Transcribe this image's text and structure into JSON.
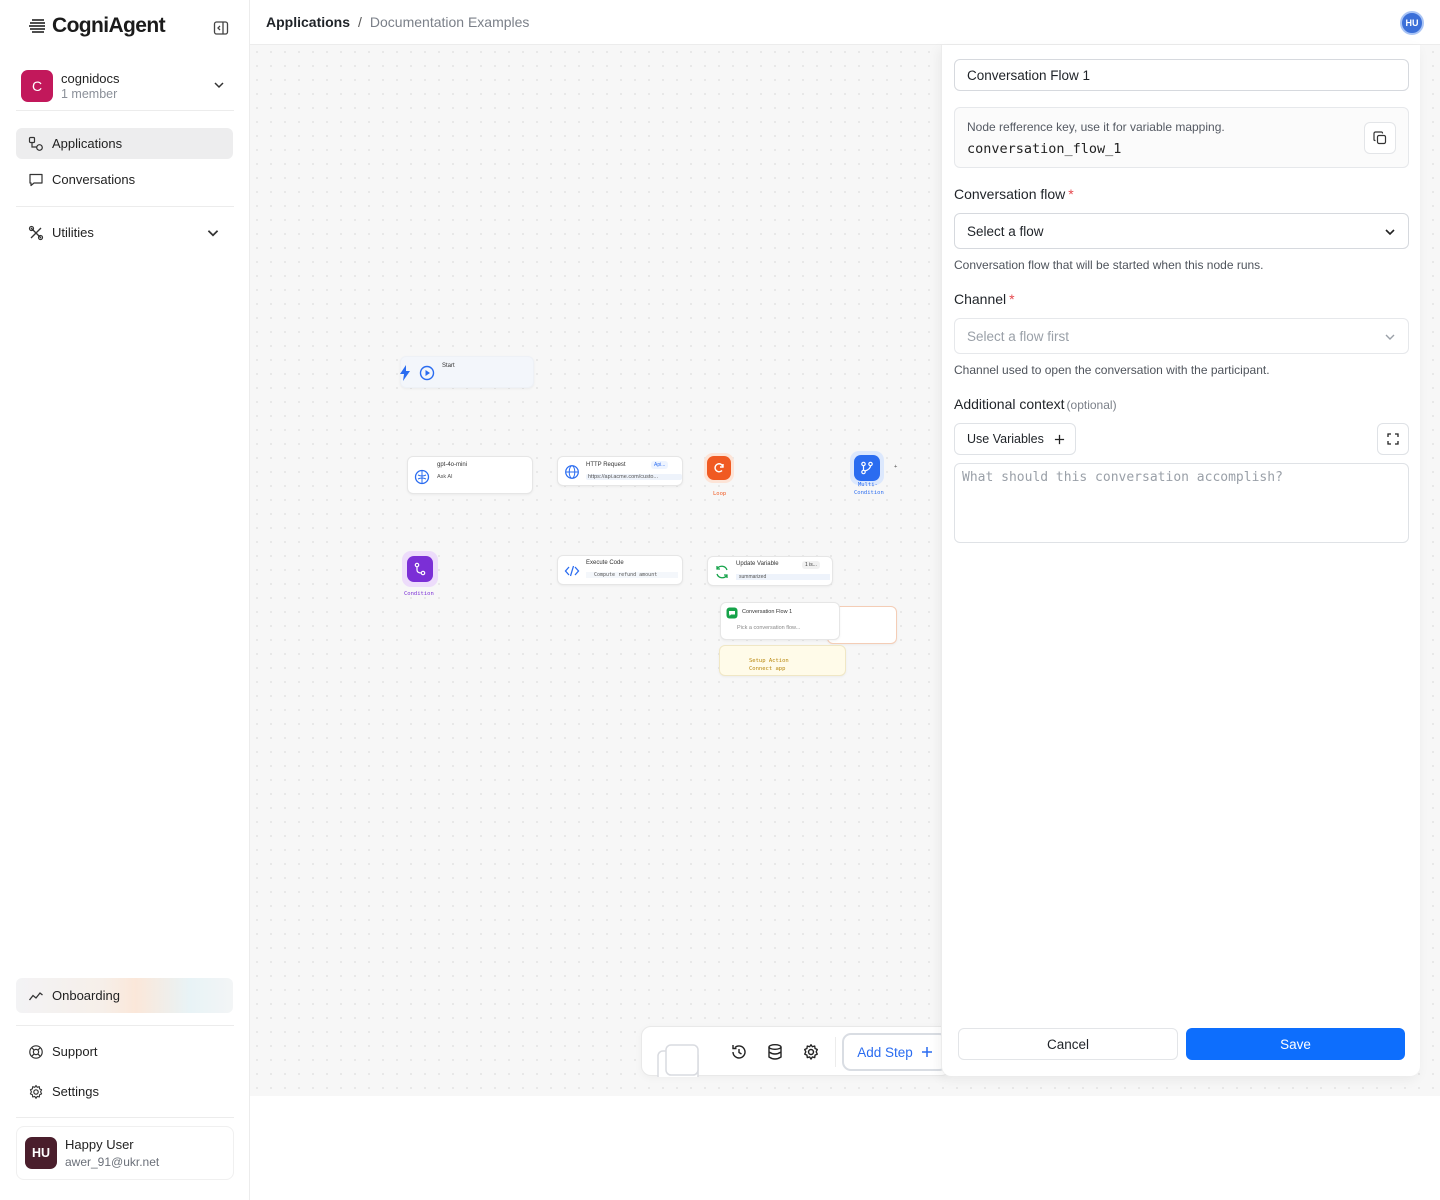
{
  "brand": {
    "name": "CogniAgent"
  },
  "org": {
    "initial": "C",
    "name": "cognidocs",
    "members": "1 member"
  },
  "nav": {
    "applications": "Applications",
    "conversations": "Conversations",
    "utilities": "Utilities",
    "onboarding": "Onboarding",
    "support": "Support",
    "settings": "Settings"
  },
  "user": {
    "initials": "HU",
    "name": "Happy User",
    "email": "awer_91@ukr.net"
  },
  "header": {
    "crumb_root": "Applications",
    "separator": "/",
    "crumb_current": "Documentation Examples",
    "avatar_initials": "HU"
  },
  "canvas": {
    "nodes": {
      "start": "Start",
      "ask_ai_model": "gpt-4o-mini",
      "ask_ai": "Ask AI",
      "http_title": "HTTP Request",
      "http_badge": "Api...",
      "http_url": "https://api.acme.com/custo...",
      "loop": "Loop",
      "multi_condition_1": "Multi-",
      "multi_condition_2": "Condition",
      "condition": "Condition",
      "execute_code": "Execute Code",
      "execute_code_sub": "Compute refund amount",
      "update_variable": "Update Variable",
      "update_variable_badge": "1 is...",
      "update_variable_sub": "summarized",
      "conv_flow_title": "Conversation Flow 1",
      "conv_flow_sub": "Pick a conversation flow...",
      "setup_action": "Setup Action",
      "connect_app": "Connect app"
    }
  },
  "toolbar": {
    "add_step": "Add Step"
  },
  "panel": {
    "node_name": "Conversation Flow 1",
    "ref_hint": "Node refference key, use it for variable mapping.",
    "ref_key": "conversation_flow_1",
    "conv_flow_label": "Conversation flow",
    "required_mark": "*",
    "conv_flow_value": "Select a flow",
    "conv_flow_help": "Conversation flow that will be started when this node runs.",
    "channel_label": "Channel",
    "channel_value": "Select a flow first",
    "channel_help": "Channel used to open the conversation with the participant.",
    "context_label": "Additional context",
    "context_optional": "(optional)",
    "use_variables": "Use Variables",
    "context_placeholder": "What should this conversation accomplish?",
    "cancel": "Cancel",
    "save": "Save"
  },
  "colors": {
    "accent": "#0d6efd",
    "org_avatar": "#c2185b",
    "user_avatar": "#4a1e2c",
    "loop": "#f05a22",
    "condition": "#7b2fd6",
    "multi_condition": "#2a6cf0"
  }
}
